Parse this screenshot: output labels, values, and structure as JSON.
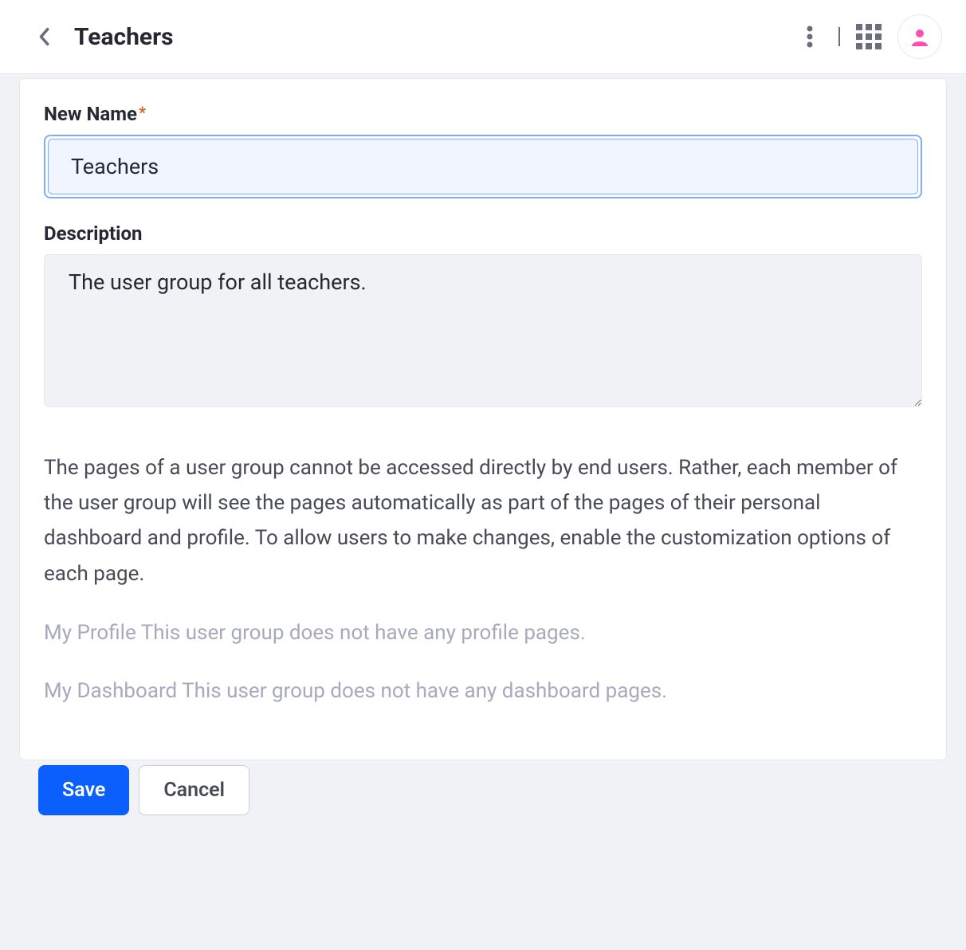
{
  "header": {
    "title": "Teachers"
  },
  "form": {
    "name_label": "New Name",
    "name_value": "Teachers",
    "description_label": "Description",
    "description_value": "The user group for all teachers."
  },
  "info": {
    "paragraph": "The pages of a user group cannot be accessed directly by end users. Rather, each member of the user group will see the pages automatically as part of the pages of their personal dashboard and profile. To allow users to make changes, enable the customization options of each page.",
    "profile_msg": "My Profile This user group does not have any profile pages.",
    "dashboard_msg": "My Dashboard This user group does not have any dashboard pages."
  },
  "actions": {
    "save": "Save",
    "cancel": "Cancel"
  }
}
